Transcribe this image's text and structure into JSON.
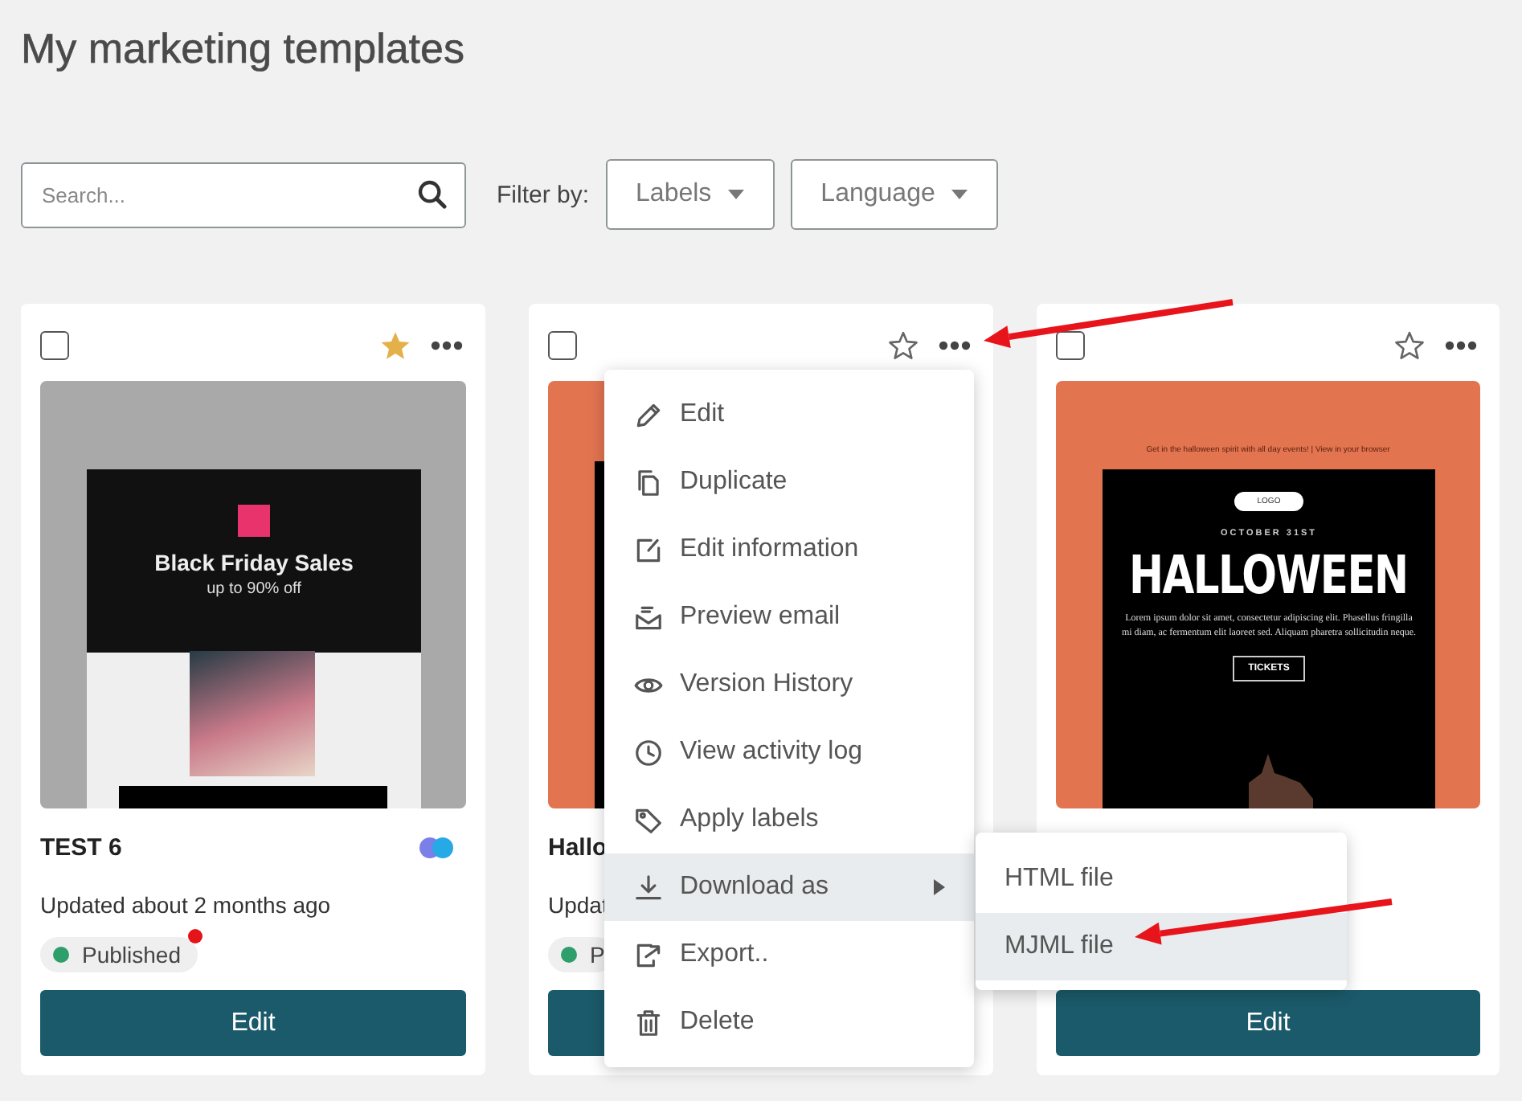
{
  "page": {
    "title": "My marketing templates"
  },
  "toolbar": {
    "search": {
      "placeholder": "Search..."
    },
    "filter_label": "Filter by:",
    "filters": [
      {
        "label": "Labels"
      },
      {
        "label": "Language"
      }
    ]
  },
  "cards": [
    {
      "checked": false,
      "starred": true,
      "thumbnail": {
        "kind": "black-friday",
        "headline": "Black Friday Sales",
        "subline": "up to 90% off"
      },
      "name": "TEST 6",
      "labels": [
        {
          "color": "#7b7fe8"
        },
        {
          "color": "#27a9e6"
        }
      ],
      "updated": "Updated about 2 months ago",
      "status": {
        "label": "Published",
        "color": "#2e9e6b",
        "unread": true
      },
      "button": "Edit"
    },
    {
      "checked": false,
      "starred": false,
      "thumbnail": {
        "kind": "covered"
      },
      "name": "Hallo",
      "updated": "Updat",
      "status": {
        "label": "P",
        "color": "#2e9e6b",
        "unread": false
      }
    },
    {
      "checked": false,
      "starred": false,
      "thumbnail": {
        "kind": "halloween",
        "topline": "Get in the halloween spirit with all day events!  |  View in your browser",
        "logo": "LOGO",
        "date": "OCTOBER 31ST",
        "headline": "HALLOWEEN",
        "body": "Lorem ipsum dolor sit amet, consectetur adipiscing elit. Phasellus fringilla mi diam, ac fermentum elit laoreet sed. Aliquam pharetra sollicitudin neque.",
        "cta": "TICKETS"
      },
      "button": "Edit"
    }
  ],
  "context_menu": {
    "items": [
      {
        "label": "Edit",
        "highlighted": false,
        "submenu": false
      },
      {
        "label": "Duplicate",
        "highlighted": false,
        "submenu": false
      },
      {
        "label": "Edit information",
        "highlighted": false,
        "submenu": false
      },
      {
        "label": "Preview email",
        "highlighted": false,
        "submenu": false
      },
      {
        "label": "Version History",
        "highlighted": false,
        "submenu": false
      },
      {
        "label": "View activity log",
        "highlighted": false,
        "submenu": false
      },
      {
        "label": "Apply labels",
        "highlighted": false,
        "submenu": false
      },
      {
        "label": "Download as",
        "highlighted": true,
        "submenu": true
      },
      {
        "label": "Export..",
        "highlighted": false,
        "submenu": false
      },
      {
        "label": "Delete",
        "highlighted": false,
        "submenu": false
      }
    ],
    "submenu": {
      "items": [
        {
          "label": "HTML file",
          "highlighted": false
        },
        {
          "label": "MJML file",
          "highlighted": true
        }
      ]
    }
  }
}
